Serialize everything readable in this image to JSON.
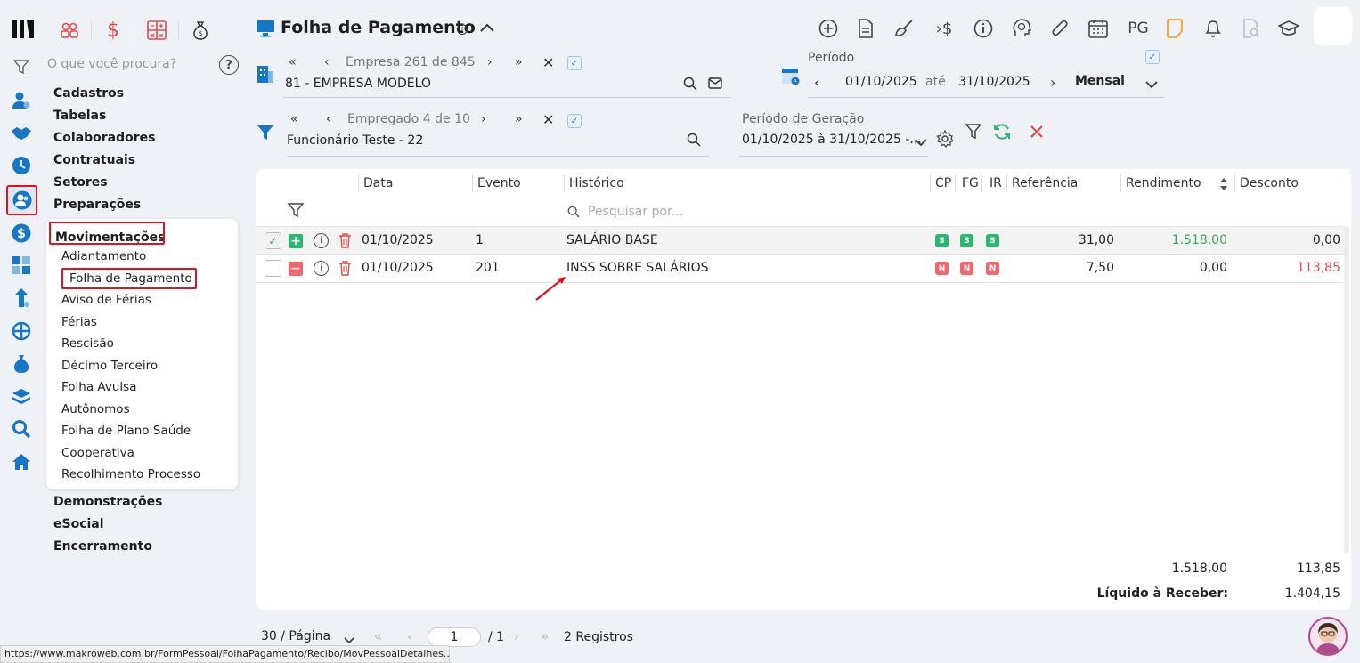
{
  "rail": {
    "logo": "logo-mark",
    "search_placeholder": "O que você procura?"
  },
  "top_tabs": [
    "people-icon",
    "dollar-icon",
    "calculator-icon",
    "money-bag-icon"
  ],
  "menu": {
    "cadastros": "Cadastros",
    "tabelas": "Tabelas",
    "colaboradores": "Colaboradores",
    "contratuais": "Contratuais",
    "setores": "Setores",
    "preparacoes": "Preparações",
    "movimentacoes": "Movimentações",
    "demonstracoes": "Demonstrações",
    "esocial": "eSocial",
    "encerramento": "Encerramento",
    "sub_items": [
      "Adiantamento",
      "Folha de Pagamento",
      "Aviso de Férias",
      "Férias",
      "Rescisão",
      "Décimo Terceiro",
      "Folha Avulsa",
      "Autônomos",
      "Folha de Plano Saúde",
      "Cooperativa",
      "Recolhimento Processo"
    ]
  },
  "header": {
    "title": "Folha de Pagamento",
    "pg_label": "PG"
  },
  "empresa": {
    "nav_text": "Empresa 261 de 845",
    "value": "81 - EMPRESA MODELO"
  },
  "periodo": {
    "label": "Período",
    "start": "01/10/2025",
    "ate": "até",
    "end": "31/10/2025",
    "mode": "Mensal"
  },
  "empregado": {
    "nav_text": "Empregado 4 de 10",
    "value": "Funcionário Teste - 22"
  },
  "geracao": {
    "label": "Período de Geração",
    "value": "01/10/2025 à 31/10/2025 -..."
  },
  "table": {
    "headers": {
      "data": "Data",
      "evento": "Evento",
      "historico": "Histórico",
      "cp": "CP",
      "fg": "FG",
      "ir": "IR",
      "referencia": "Referência",
      "rendimento": "Rendimento",
      "desconto": "Desconto"
    },
    "search_placeholder": "Pesquisar por...",
    "rows": [
      {
        "data": "01/10/2025",
        "evento": "1",
        "historico": "SALÁRIO BASE",
        "cp": "S",
        "fg": "S",
        "ir": "S",
        "referencia": "31,00",
        "rendimento": "1.518,00",
        "desconto": "0,00"
      },
      {
        "data": "01/10/2025",
        "evento": "201",
        "historico": "INSS SOBRE SALÁRIOS",
        "cp": "N",
        "fg": "N",
        "ir": "N",
        "referencia": "7,50",
        "rendimento": "0,00",
        "desconto": "113,85"
      }
    ],
    "totals": {
      "rendimento": "1.518,00",
      "desconto": "113,85",
      "liquido_label": "Líquido à Receber:",
      "liquido_value": "1.404,15"
    }
  },
  "pagination": {
    "per_page": "30 / Página",
    "page": "1",
    "total_pages": "/ 1",
    "records": "2 Registros"
  },
  "statusbar": {
    "url": "https://www.makroweb.com.br/FormPessoal/FolhaPagamento/Recibo/MovPessoalDetalhes...."
  },
  "colors": {
    "accent_green": "#3aa55b",
    "accent_red": "#e44a4a",
    "badge_red": "#f0666c",
    "badge_green": "#2bb673",
    "brand_blue": "#1677c7"
  }
}
